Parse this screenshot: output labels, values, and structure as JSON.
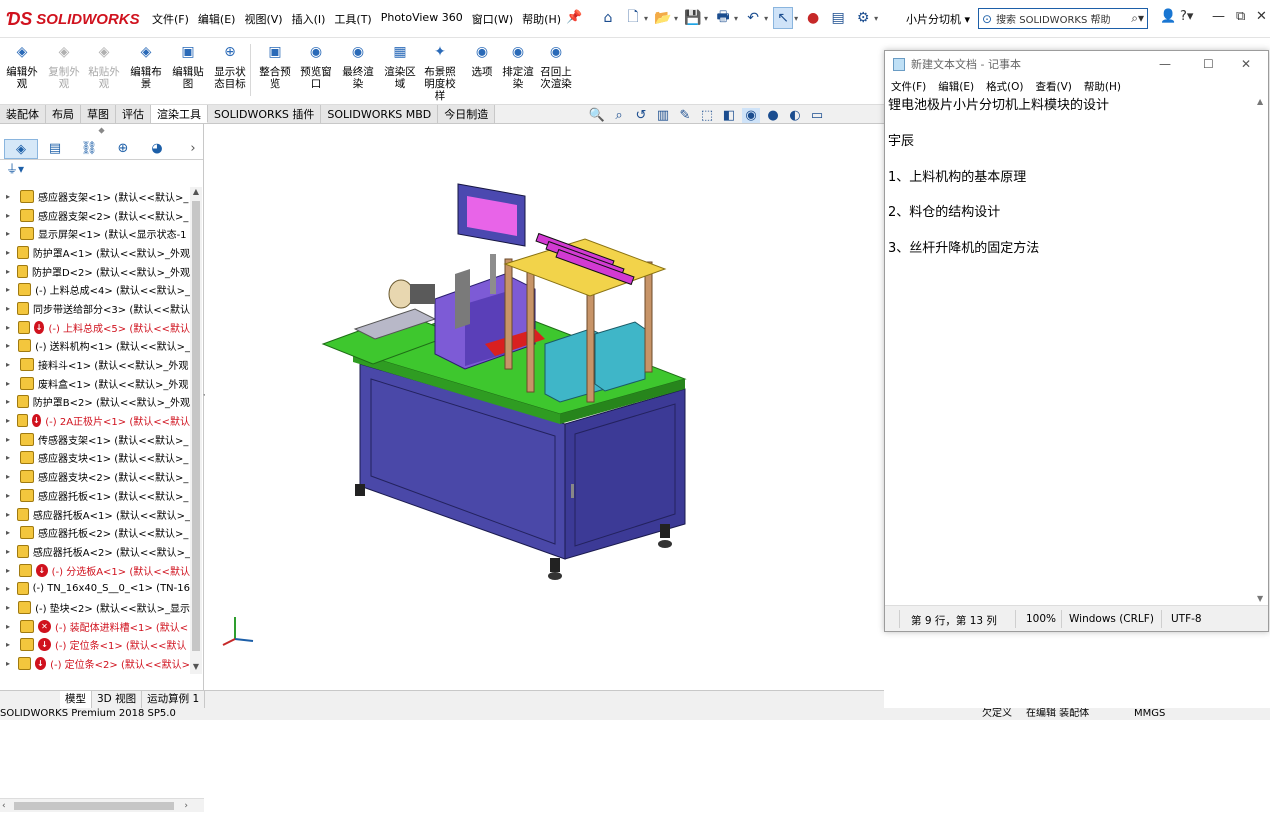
{
  "app": {
    "logo": "SOLIDWORKS",
    "menus": [
      "文件(F)",
      "编辑(E)",
      "视图(V)",
      "插入(I)",
      "工具(T)",
      "PhotoView 360",
      "窗口(W)",
      "帮助(H)"
    ],
    "document_title": "小片分切机",
    "search_placeholder": "搜索 SOLIDWORKS 帮助"
  },
  "command_bar": [
    {
      "label": "编辑外观",
      "enabled": true,
      "icon": "edit-appearance-icon"
    },
    {
      "label": "复制外观",
      "enabled": false,
      "icon": "copy-appearance-icon"
    },
    {
      "label": "粘贴外观",
      "enabled": false,
      "icon": "paste-appearance-icon"
    },
    {
      "label": "编辑布景",
      "enabled": true,
      "icon": "edit-scene-icon"
    },
    {
      "label": "编辑贴图",
      "enabled": true,
      "icon": "edit-decal-icon"
    },
    {
      "label": "显示状态目标",
      "enabled": true,
      "icon": "display-state-icon"
    },
    {
      "label": "整合预览",
      "enabled": true,
      "icon": "integrated-preview-icon"
    },
    {
      "label": "预览窗口",
      "enabled": true,
      "icon": "preview-window-icon"
    },
    {
      "label": "最终渲染",
      "enabled": true,
      "icon": "final-render-icon"
    },
    {
      "label": "渲染区域",
      "enabled": true,
      "icon": "render-region-icon"
    },
    {
      "label": "布景照明度校样",
      "enabled": true,
      "icon": "scene-illumination-icon"
    },
    {
      "label": "选项",
      "enabled": true,
      "icon": "options-icon"
    },
    {
      "label": "排定渲染",
      "enabled": true,
      "icon": "schedule-render-icon"
    },
    {
      "label": "召回上次渲染",
      "enabled": true,
      "icon": "recall-render-icon"
    }
  ],
  "tabs": [
    "装配体",
    "布局",
    "草图",
    "评估",
    "渲染工具",
    "SOLIDWORKS 插件",
    "SOLIDWORKS MBD",
    "今日制造"
  ],
  "active_tab": "渲染工具",
  "tree": [
    {
      "label": "感应器支架<1> (默认<<默认>_",
      "state": "normal"
    },
    {
      "label": "感应器支架<2> (默认<<默认>_",
      "state": "normal"
    },
    {
      "label": "显示屏架<1> (默认<显示状态-1",
      "state": "normal"
    },
    {
      "label": "防护罩A<1> (默认<<默认>_外观",
      "state": "normal"
    },
    {
      "label": "防护罩D<2> (默认<<默认>_外观",
      "state": "normal"
    },
    {
      "label": "(-) 上料总成<4> (默认<<默认>_",
      "state": "normal"
    },
    {
      "label": "同步带送给部分<3> (默认<<默认",
      "state": "normal"
    },
    {
      "label": "(-) 上料总成<5> (默认<<默认",
      "state": "error"
    },
    {
      "label": "(-) 送料机构<1> (默认<<默认>_",
      "state": "normal"
    },
    {
      "label": "接料斗<1> (默认<<默认>_外观",
      "state": "normal"
    },
    {
      "label": "废料盒<1> (默认<<默认>_外观",
      "state": "normal"
    },
    {
      "label": "防护罩B<2> (默认<<默认>_外观",
      "state": "normal"
    },
    {
      "label": "(-) 2A正极片<1> (默认<<默认",
      "state": "error"
    },
    {
      "label": "传感器支架<1> (默认<<默认>_",
      "state": "normal"
    },
    {
      "label": "感应器支块<1> (默认<<默认>_",
      "state": "normal"
    },
    {
      "label": "感应器支块<2> (默认<<默认>_",
      "state": "normal"
    },
    {
      "label": "感应器托板<1> (默认<<默认>_",
      "state": "normal"
    },
    {
      "label": "感应器托板A<1> (默认<<默认>_",
      "state": "normal"
    },
    {
      "label": "感应器托板<2> (默认<<默认>_",
      "state": "normal"
    },
    {
      "label": "感应器托板A<2> (默认<<默认>_",
      "state": "normal"
    },
    {
      "label": "(-) 分选板A<1> (默认<<默认",
      "state": "error"
    },
    {
      "label": "(-) TN_16x40_S__0_<1> (TN-16",
      "state": "normal"
    },
    {
      "label": "(-) 垫块<2> (默认<<默认>_显示",
      "state": "normal"
    },
    {
      "label": "(-) 装配体进料槽<1> (默认<",
      "state": "error-x"
    },
    {
      "label": "(-) 定位条<1> (默认<<默认",
      "state": "error"
    },
    {
      "label": "(-) 定位条<2> (默认<<默认>",
      "state": "error"
    }
  ],
  "bottom_tabs": [
    "模型",
    "3D 视图",
    "运动算例 1"
  ],
  "status": {
    "version": "SOLIDWORKS Premium 2018 SP5.0",
    "definition": "欠定义",
    "mode": "在编辑 装配体",
    "units": "MMGS"
  },
  "notepad": {
    "title": "新建文本文档 - 记事本",
    "menus": [
      "文件(F)",
      "编辑(E)",
      "格式(O)",
      "查看(V)",
      "帮助(H)"
    ],
    "lines": [
      "锂电池极片小片分切机上料模块的设计",
      "",
      "宇辰",
      "",
      "1、上料机构的基本原理",
      "",
      "2、料仓的结构设计",
      "",
      "3、丝杆升降机的固定方法"
    ],
    "status_pos": "第 9 行，第 13 列",
    "zoom": "100%",
    "line_ending": "Windows (CRLF)",
    "encoding": "UTF-8"
  },
  "colors": {
    "accent": "#d0121e",
    "link": "#1d5fa8",
    "base": "#3f3d99",
    "table": "#3ec72e"
  }
}
